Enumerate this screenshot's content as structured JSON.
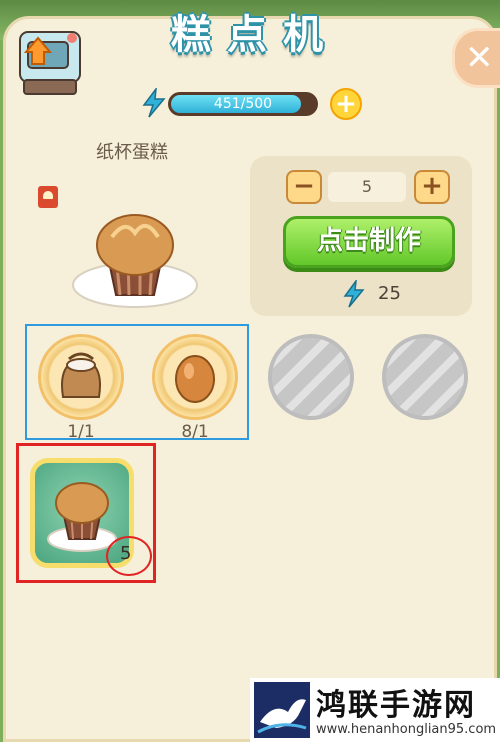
{
  "window": {
    "title": "糕点机"
  },
  "energy": {
    "current": 451,
    "max": 500,
    "text": "451/500"
  },
  "recipe": {
    "name": "纸杯蛋糕",
    "quantity": "5",
    "make_label": "点击制作",
    "energy_cost": "25"
  },
  "ingredients": [
    {
      "name": "flour",
      "icon": "flour-sack-icon",
      "count": "1/1"
    },
    {
      "name": "egg",
      "icon": "egg-icon",
      "count": "8/1"
    },
    {
      "name": "locked",
      "icon": "locked-slot-icon",
      "count": ""
    },
    {
      "name": "locked",
      "icon": "locked-slot-icon",
      "count": ""
    }
  ],
  "products": [
    {
      "icon": "cupcake-icon",
      "count": "5"
    }
  ],
  "watermark": {
    "title": "鸿联手游网",
    "url": "www.henanhonglian95.com"
  },
  "colors": {
    "accent": "#2fb1d8",
    "make_button": "#63c82a",
    "highlight_blue": "#2e9be0",
    "highlight_red": "#e02424"
  }
}
